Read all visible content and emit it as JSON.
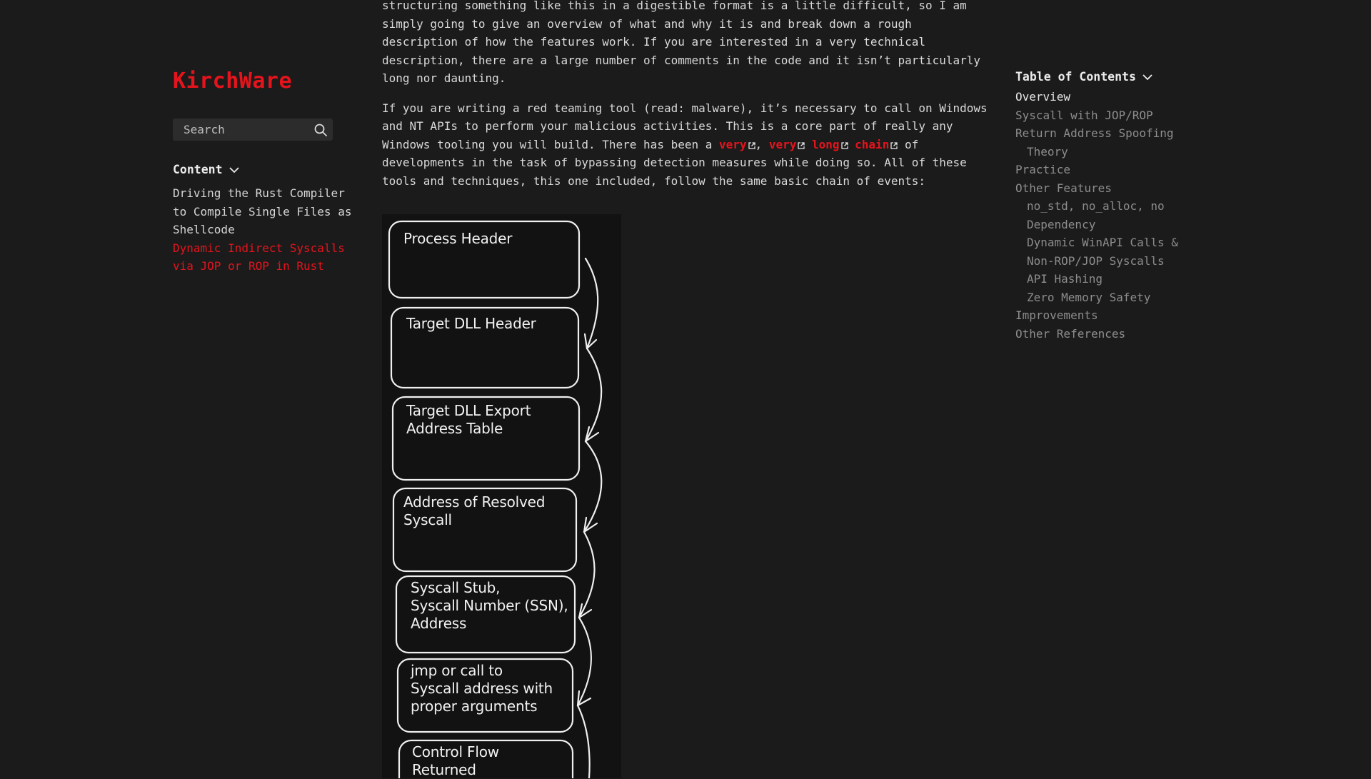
{
  "site": {
    "brand": "KirchWare"
  },
  "search": {
    "placeholder": "Search"
  },
  "sidebar": {
    "heading": "Content",
    "items": [
      {
        "label": "Driving the Rust Compiler to Compile Single Files as Shellcode",
        "active": false
      },
      {
        "label": "Dynamic Indirect Syscalls via JOP or ROP in Rust",
        "active": true
      }
    ]
  },
  "article": {
    "para1": "structuring something like this in a digestible format is a little difficult, so I am simply going to give an overview of what and why it is and break down a rough description of how the features work. If you are interested in a very technical description, there are a large number of comments in the code and it isn’t particularly long nor daunting.",
    "para2_before": "If you are writing a red teaming tool (read: malware), it’s necessary to call on Windows and NT APIs to perform your malicious activities. This is a core part of really any Windows tooling you will build. There has been a ",
    "links": [
      "very",
      "very",
      "long",
      "chain"
    ],
    "sep_comma": ", ",
    "sep_space": " ",
    "para2_after": " of developments in the task of bypassing detection measures while doing so. All of these tools and techniques, this one included, follow the same basic chain of events:"
  },
  "diagram": {
    "steps": [
      "Process Header",
      "Target DLL Header",
      "Target DLL Export\nAddress Table",
      "Address of Resolved\nSyscall",
      "Syscall Stub,\nSyscall Number (SSN),\nAddress",
      "jmp or call to\nSyscall address with\nproper arguments",
      "Control Flow\nReturned"
    ]
  },
  "toc": {
    "heading": "Table of Contents",
    "items": [
      {
        "label": "Overview",
        "level": 0,
        "current": true
      },
      {
        "label": "Syscall with JOP/ROP",
        "level": 0
      },
      {
        "label": "Return Address Spoofing",
        "level": 0
      },
      {
        "label": "Theory",
        "level": 1
      },
      {
        "label": "Practice",
        "level": 0
      },
      {
        "label": "Other Features",
        "level": 0
      },
      {
        "label": "no_std, no_alloc, no\nDependency",
        "level": 1
      },
      {
        "label": "Dynamic WinAPI Calls &\nNon-ROP/JOP Syscalls",
        "level": 1
      },
      {
        "label": "API Hashing",
        "level": 1
      },
      {
        "label": "Zero Memory Safety",
        "level": 1
      },
      {
        "label": "Improvements",
        "level": 0
      },
      {
        "label": "Other References",
        "level": 0
      }
    ]
  },
  "colors": {
    "accent": "#e5141c",
    "background": "#1b1b1b",
    "diagram_bg": "#121212"
  }
}
